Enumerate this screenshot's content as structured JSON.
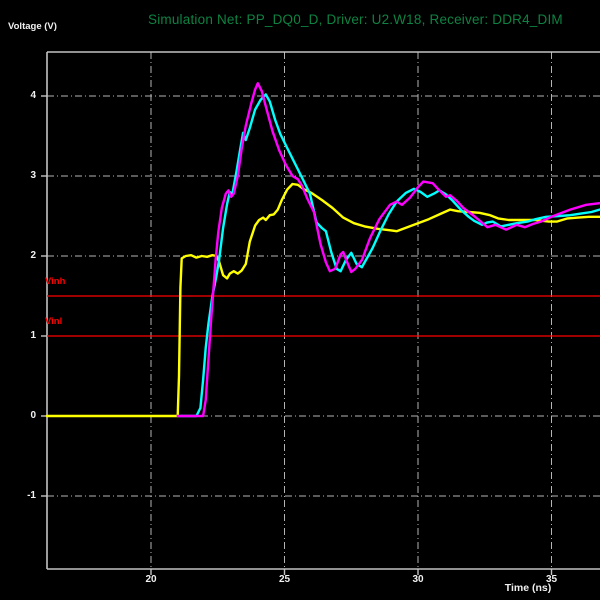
{
  "title": {
    "text": "Simulation Net: PP_DQ0_D, Driver: U2.W18, Receiver: DDR4_DIM",
    "color": "#0e8242"
  },
  "axes": {
    "y_label": "Voltage (V)",
    "x_label": "Time (ns)"
  },
  "thresholds": [
    {
      "label": "Vinh",
      "value": 1.5,
      "color": "#ff0000"
    },
    {
      "label": "Vinl",
      "value": 1.0,
      "color": "#ff0000"
    }
  ],
  "chart_data": {
    "type": "line",
    "title": "Simulation Net: PP_DQ0_D, Driver: U2.W18, Receiver: DDR4_DIM",
    "xlabel": "Time (ns)",
    "ylabel": "Voltage (V)",
    "xlim": [
      16.1,
      36.8
    ],
    "ylim": [
      -1.91,
      4.55
    ],
    "x_ticks": [
      20,
      25,
      30,
      35
    ],
    "y_ticks": [
      4,
      3,
      2,
      1,
      0,
      -1
    ],
    "grid": true,
    "grid_style": "dash-dot",
    "legend_position": "none",
    "thresholds": [
      {
        "label": "Vinh",
        "value": 1.5
      },
      {
        "label": "Vinl",
        "value": 1.0
      }
    ],
    "series": [
      {
        "name": "yellow",
        "color": "#ffff00",
        "points": [
          [
            16.1,
            0
          ],
          [
            21.0,
            0
          ],
          [
            21.05,
            0.5
          ],
          [
            21.1,
            1.6
          ],
          [
            21.15,
            1.97
          ],
          [
            21.3,
            2.0
          ],
          [
            21.5,
            2.01
          ],
          [
            21.7,
            1.98
          ],
          [
            21.9,
            2.0
          ],
          [
            22.1,
            1.99
          ],
          [
            22.3,
            2.01
          ],
          [
            22.45,
            2.0
          ],
          [
            22.55,
            1.93
          ],
          [
            22.7,
            1.76
          ],
          [
            22.85,
            1.72
          ],
          [
            22.95,
            1.78
          ],
          [
            23.1,
            1.81
          ],
          [
            23.25,
            1.78
          ],
          [
            23.4,
            1.82
          ],
          [
            23.55,
            1.9
          ],
          [
            23.7,
            2.18
          ],
          [
            23.9,
            2.38
          ],
          [
            24.05,
            2.45
          ],
          [
            24.2,
            2.48
          ],
          [
            24.3,
            2.45
          ],
          [
            24.45,
            2.51
          ],
          [
            24.6,
            2.52
          ],
          [
            24.75,
            2.58
          ],
          [
            24.9,
            2.7
          ],
          [
            25.1,
            2.83
          ],
          [
            25.3,
            2.9
          ],
          [
            25.5,
            2.89
          ],
          [
            25.7,
            2.84
          ],
          [
            26.0,
            2.79
          ],
          [
            26.4,
            2.7
          ],
          [
            26.8,
            2.6
          ],
          [
            27.2,
            2.48
          ],
          [
            27.6,
            2.41
          ],
          [
            28.0,
            2.37
          ],
          [
            28.5,
            2.34
          ],
          [
            29.0,
            2.32
          ],
          [
            29.2,
            2.31
          ],
          [
            29.6,
            2.36
          ],
          [
            30.0,
            2.41
          ],
          [
            30.4,
            2.46
          ],
          [
            30.8,
            2.52
          ],
          [
            31.2,
            2.58
          ],
          [
            31.5,
            2.56
          ],
          [
            31.9,
            2.55
          ],
          [
            32.3,
            2.54
          ],
          [
            32.7,
            2.51
          ],
          [
            33.0,
            2.47
          ],
          [
            33.4,
            2.45
          ],
          [
            33.9,
            2.45
          ],
          [
            34.4,
            2.45
          ],
          [
            34.9,
            2.43
          ],
          [
            35.2,
            2.43
          ],
          [
            35.6,
            2.47
          ],
          [
            36.0,
            2.48
          ],
          [
            36.4,
            2.49
          ],
          [
            36.8,
            2.49
          ]
        ]
      },
      {
        "name": "cyan",
        "color": "#00ffff",
        "points": [
          [
            21.0,
            0
          ],
          [
            21.7,
            0
          ],
          [
            21.85,
            0.1
          ],
          [
            21.95,
            0.45
          ],
          [
            22.05,
            0.85
          ],
          [
            22.15,
            1.15
          ],
          [
            22.3,
            1.5
          ],
          [
            22.45,
            1.75
          ],
          [
            22.55,
            1.95
          ],
          [
            22.7,
            2.35
          ],
          [
            22.85,
            2.65
          ],
          [
            22.95,
            2.8
          ],
          [
            23.05,
            2.78
          ],
          [
            23.2,
            3.05
          ],
          [
            23.35,
            3.35
          ],
          [
            23.45,
            3.54
          ],
          [
            23.55,
            3.45
          ],
          [
            23.7,
            3.6
          ],
          [
            23.9,
            3.83
          ],
          [
            24.1,
            3.95
          ],
          [
            24.3,
            4.02
          ],
          [
            24.45,
            3.93
          ],
          [
            24.65,
            3.7
          ],
          [
            24.85,
            3.52
          ],
          [
            25.1,
            3.35
          ],
          [
            25.4,
            3.15
          ],
          [
            25.7,
            2.95
          ],
          [
            25.95,
            2.78
          ],
          [
            26.2,
            2.42
          ],
          [
            26.4,
            2.35
          ],
          [
            26.55,
            2.31
          ],
          [
            26.75,
            2.05
          ],
          [
            26.95,
            1.84
          ],
          [
            27.1,
            1.81
          ],
          [
            27.3,
            1.95
          ],
          [
            27.5,
            2.04
          ],
          [
            27.7,
            1.9
          ],
          [
            27.9,
            1.86
          ],
          [
            28.1,
            1.98
          ],
          [
            28.3,
            2.1
          ],
          [
            28.6,
            2.32
          ],
          [
            28.9,
            2.52
          ],
          [
            29.2,
            2.68
          ],
          [
            29.55,
            2.79
          ],
          [
            29.85,
            2.84
          ],
          [
            30.1,
            2.8
          ],
          [
            30.35,
            2.74
          ],
          [
            30.6,
            2.78
          ],
          [
            30.8,
            2.82
          ],
          [
            31.05,
            2.77
          ],
          [
            31.3,
            2.69
          ],
          [
            31.6,
            2.58
          ],
          [
            31.9,
            2.49
          ],
          [
            32.1,
            2.44
          ],
          [
            32.4,
            2.39
          ],
          [
            32.6,
            2.42
          ],
          [
            32.8,
            2.43
          ],
          [
            33.1,
            2.37
          ],
          [
            33.4,
            2.39
          ],
          [
            33.7,
            2.41
          ],
          [
            34.1,
            2.43
          ],
          [
            34.4,
            2.46
          ],
          [
            34.8,
            2.49
          ],
          [
            35.3,
            2.5
          ],
          [
            35.7,
            2.51
          ],
          [
            36.1,
            2.53
          ],
          [
            36.5,
            2.55
          ],
          [
            36.8,
            2.58
          ]
        ]
      },
      {
        "name": "magenta",
        "color": "#ff00ff",
        "points": [
          [
            21.0,
            0
          ],
          [
            21.95,
            0
          ],
          [
            22.05,
            0.2
          ],
          [
            22.15,
            0.7
          ],
          [
            22.25,
            1.2
          ],
          [
            22.32,
            1.5
          ],
          [
            22.42,
            1.95
          ],
          [
            22.52,
            2.3
          ],
          [
            22.65,
            2.6
          ],
          [
            22.8,
            2.78
          ],
          [
            22.9,
            2.82
          ],
          [
            23.0,
            2.74
          ],
          [
            23.1,
            2.78
          ],
          [
            23.25,
            3.0
          ],
          [
            23.4,
            3.35
          ],
          [
            23.55,
            3.63
          ],
          [
            23.75,
            3.9
          ],
          [
            23.9,
            4.08
          ],
          [
            24.0,
            4.16
          ],
          [
            24.15,
            4.06
          ],
          [
            24.3,
            3.87
          ],
          [
            24.55,
            3.56
          ],
          [
            24.8,
            3.32
          ],
          [
            25.05,
            3.14
          ],
          [
            25.3,
            3.0
          ],
          [
            25.5,
            2.96
          ],
          [
            25.65,
            2.88
          ],
          [
            25.85,
            2.72
          ],
          [
            26.1,
            2.55
          ],
          [
            26.35,
            2.15
          ],
          [
            26.55,
            1.92
          ],
          [
            26.7,
            1.81
          ],
          [
            26.9,
            1.84
          ],
          [
            27.1,
            2.02
          ],
          [
            27.2,
            2.05
          ],
          [
            27.35,
            1.92
          ],
          [
            27.5,
            1.8
          ],
          [
            27.65,
            1.84
          ],
          [
            27.9,
            1.95
          ],
          [
            28.2,
            2.22
          ],
          [
            28.55,
            2.46
          ],
          [
            28.95,
            2.64
          ],
          [
            29.2,
            2.68
          ],
          [
            29.4,
            2.64
          ],
          [
            29.7,
            2.73
          ],
          [
            30.0,
            2.86
          ],
          [
            30.2,
            2.93
          ],
          [
            30.55,
            2.91
          ],
          [
            30.8,
            2.82
          ],
          [
            31.05,
            2.74
          ],
          [
            31.2,
            2.76
          ],
          [
            31.45,
            2.69
          ],
          [
            31.7,
            2.6
          ],
          [
            32.1,
            2.5
          ],
          [
            32.6,
            2.36
          ],
          [
            32.9,
            2.39
          ],
          [
            33.3,
            2.33
          ],
          [
            33.7,
            2.39
          ],
          [
            34.0,
            2.36
          ],
          [
            34.3,
            2.4
          ],
          [
            34.6,
            2.43
          ],
          [
            35.0,
            2.49
          ],
          [
            35.7,
            2.58
          ],
          [
            36.3,
            2.64
          ],
          [
            36.8,
            2.66
          ]
        ]
      }
    ]
  }
}
